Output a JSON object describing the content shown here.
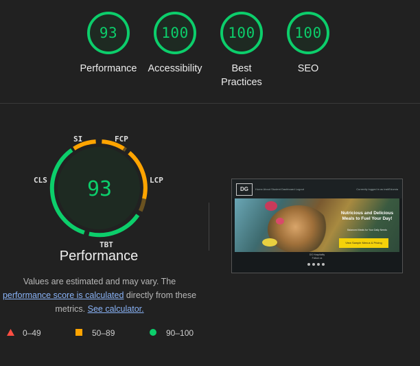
{
  "summary": {
    "categories": [
      {
        "label": "Performance",
        "score": "93"
      },
      {
        "label": "Accessibility",
        "score": "100"
      },
      {
        "label": "Best\nPractices",
        "score": "100"
      },
      {
        "label": "SEO",
        "score": "100"
      }
    ]
  },
  "detail": {
    "score": "93",
    "title": "Performance",
    "metrics": {
      "si": "SI",
      "fcp": "FCP",
      "lcp": "LCP",
      "tbt": "TBT",
      "cls": "CLS"
    },
    "note": {
      "part1": "Values are estimated and may vary. The",
      "link1": "performance score is calculated",
      "part2": "directly from these metrics.",
      "link2": "See calculator."
    }
  },
  "legend": [
    {
      "range": "0–49",
      "color": "#ff4e42",
      "icon": "triangle-icon"
    },
    {
      "range": "50–89",
      "color": "#ffa400",
      "icon": "square-icon"
    },
    {
      "range": "90–100",
      "color": "#0cce6b",
      "icon": "circle-icon"
    }
  ],
  "thumbnail": {
    "logo": "DG",
    "nav_links": "Home   About   Student Dashboard   Logout",
    "nav_right": "Currently logged in as instiEdumia",
    "hero_title": "Nutricious and Delicious Meals to Fuel Your Day!",
    "hero_subtitle": "Balanced Meals for Your Daily Needs",
    "hero_button": "View Sample Menus & Pricing",
    "footer_line1": "DG Hospitality",
    "footer_line2": "Follow us"
  },
  "colors": {
    "pass": "#0cce6b",
    "average": "#ffa400",
    "fail": "#ff4e42",
    "background": "#212121"
  }
}
